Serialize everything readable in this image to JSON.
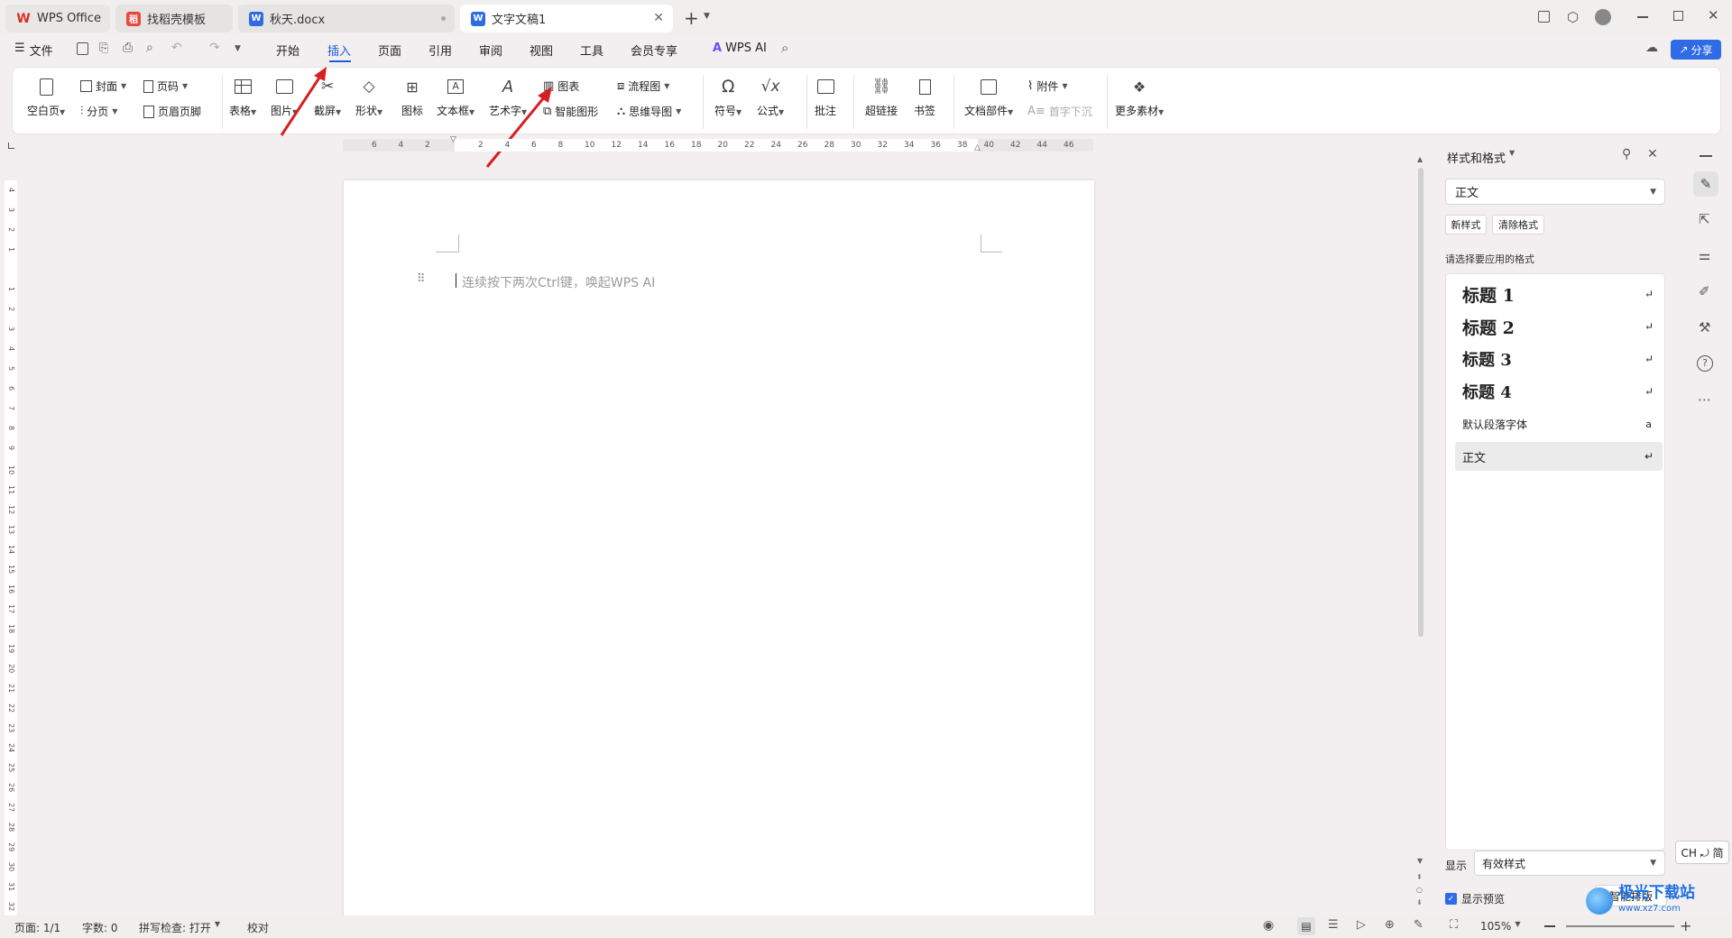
{
  "tabs": [
    {
      "label": "WPS Office",
      "icon": "wps-logo-icon",
      "color": "#d93025"
    },
    {
      "label": "找稻壳模板",
      "icon": "docer-icon",
      "color": "#e8483c"
    },
    {
      "label": "秋天.docx",
      "icon": "word-doc-icon",
      "color": "#2f6be5"
    },
    {
      "label": "文字文稿1",
      "icon": "word-doc-icon",
      "color": "#2f6be5"
    }
  ],
  "menubar": {
    "file": "文件",
    "items": [
      "开始",
      "插入",
      "页面",
      "引用",
      "审阅",
      "视图",
      "工具",
      "会员专享"
    ],
    "active": "插入",
    "wps_ai": "WPS AI",
    "share": "分享"
  },
  "ribbon": {
    "blank_page": "空白页",
    "cover": "封面",
    "page_number": "页码",
    "section_break": "分页",
    "header_footer": "页眉页脚",
    "table": "表格",
    "picture": "图片",
    "screenshot": "截屏",
    "shape": "形状",
    "icon": "图标",
    "textbox": "文本框",
    "wordart": "艺术字",
    "chart": "图表",
    "smart_graphic": "智能图形",
    "flowchart": "流程图",
    "mindmap": "思维导图",
    "symbol": "符号",
    "formula": "公式",
    "comment": "批注",
    "hyperlink": "超链接",
    "bookmark": "书签",
    "doc_parts": "文档部件",
    "attachment": "附件",
    "drop_cap": "首字下沉",
    "more_materials": "更多素材"
  },
  "ruler": {
    "ticks": [
      "6",
      "4",
      "2",
      "",
      "2",
      "4",
      "6",
      "8",
      "10",
      "12",
      "14",
      "16",
      "18",
      "20",
      "22",
      "24",
      "26",
      "28",
      "30",
      "32",
      "34",
      "36",
      "38",
      "40",
      "42",
      "44",
      "46"
    ],
    "v_ticks": [
      "4",
      "3",
      "2",
      "1",
      "",
      "1",
      "2",
      "3",
      "4",
      "5",
      "6",
      "7",
      "8",
      "9",
      "10",
      "11",
      "12",
      "13",
      "14",
      "15",
      "16",
      "17",
      "18",
      "19",
      "20",
      "21",
      "22",
      "23",
      "24",
      "25",
      "26",
      "27",
      "28",
      "29",
      "30",
      "31",
      "32"
    ]
  },
  "document": {
    "placeholder": "连续按下两次Ctrl键，唤起WPS AI"
  },
  "panel": {
    "title": "样式和格式",
    "current_style": "正文",
    "new_style": "新样式",
    "clear_format": "清除格式",
    "prompt": "请选择要应用的格式",
    "styles": [
      {
        "label": "标题  1",
        "kind": "heading"
      },
      {
        "label": "标题  2",
        "kind": "heading"
      },
      {
        "label": "标题  3",
        "kind": "heading"
      },
      {
        "label": "标题  4",
        "kind": "heading"
      },
      {
        "label": "默认段落字体",
        "kind": "plain"
      },
      {
        "label": "正文",
        "kind": "plain-selected"
      }
    ],
    "show_label": "显示",
    "show_value": "有效样式",
    "preview_label": "显示预览",
    "smart_layout": "智能排版",
    "ime": "CH ⤾ 简"
  },
  "status": {
    "page": "页面: 1/1",
    "words": "字数: 0",
    "spell": "拼写检查: 打开",
    "proof": "校对",
    "zoom": "105%"
  },
  "watermark": "极光下载站",
  "watermark_url": "www.xz7.com"
}
